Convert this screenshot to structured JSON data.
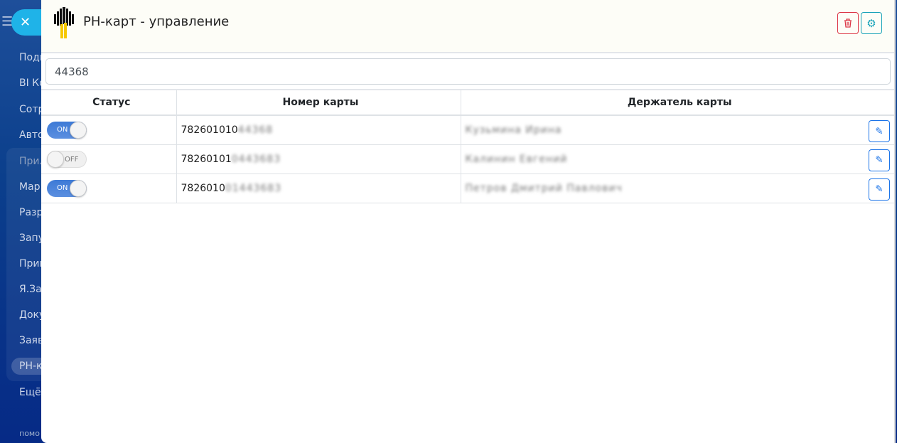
{
  "sidebar": {
    "items": [
      "Подк",
      "BI Ко",
      "Сотр",
      "Авто",
      "Прил",
      "Мар",
      "Разр",
      "Запу",
      "Прив",
      "Я.За",
      "Доку",
      "Заяв",
      "РН-к",
      "Ещё"
    ],
    "footer": "помо"
  },
  "modal": {
    "title": "РН-карт - управление",
    "search_value": "44368"
  },
  "table": {
    "headers": [
      "Статус",
      "Номер карты",
      "Держатель карты"
    ],
    "rows": [
      {
        "status": "ON",
        "card_visible": "782601010",
        "card_hidden": "44368",
        "holder_hidden": "Кузьмина Ирина"
      },
      {
        "status": "OFF",
        "card_visible": "78260101",
        "card_hidden": "0443683",
        "holder_hidden": "Калинин Евгений"
      },
      {
        "status": "ON",
        "card_visible": "7826010",
        "card_hidden": "01443683",
        "holder_hidden": "Петров Дмитрий Павлович"
      }
    ]
  },
  "colors": {
    "danger": "#dc3545",
    "info": "#17a2b8",
    "primary": "#1a73e8"
  }
}
